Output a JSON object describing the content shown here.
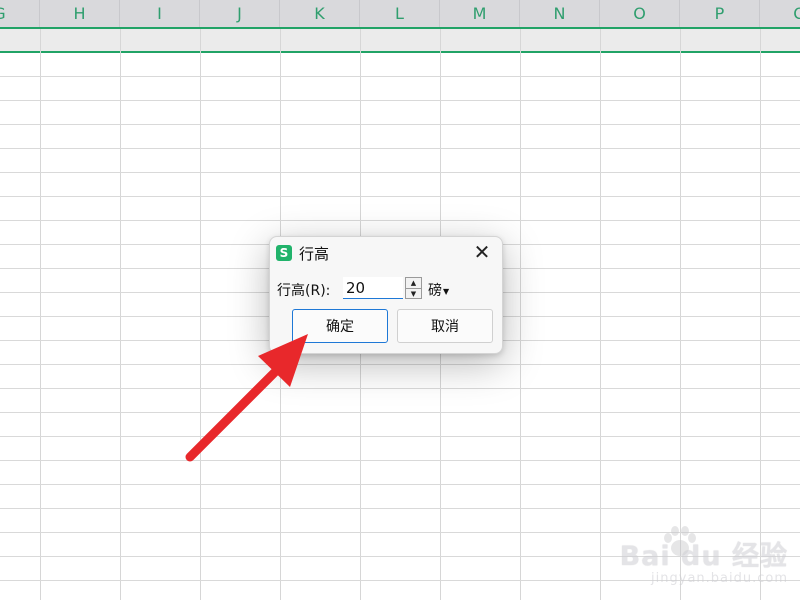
{
  "columns": [
    "G",
    "H",
    "I",
    "J",
    "K",
    "L",
    "M",
    "N",
    "O",
    "P",
    "Q"
  ],
  "dialog": {
    "title": "行高",
    "app_icon_letter": "S",
    "close_label": "✕",
    "field_label": "行高(R):",
    "value": "20",
    "unit": "磅",
    "ok_label": "确定",
    "cancel_label": "取消"
  },
  "watermark": {
    "main": "Bai du 经验",
    "sub": "jingyan.baidu.com"
  },
  "colors": {
    "accent": "#21a366",
    "arrow": "#e8282b",
    "focus": "#1e78d6"
  },
  "icons": {
    "app": "wps-spreadsheet-icon",
    "close": "close-icon",
    "spin_up": "up-triangle",
    "spin_down": "down-triangle",
    "caret": "caret-down-icon",
    "annotation": "red-arrow"
  }
}
